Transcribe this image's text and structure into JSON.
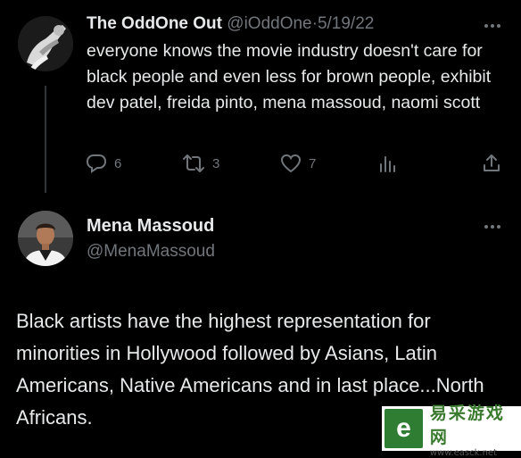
{
  "reply_tweet": {
    "display_name": "The OddOne Out",
    "handle": "@iOddOne",
    "separator": "·",
    "date": "5/19/22",
    "text": "everyone knows the movie industry doesn't care for black people and even less for brown people, exhibit dev patel, freida pinto, mena massoud, naomi scott",
    "actions": {
      "reply_count": "6",
      "retweet_count": "3",
      "like_count": "7"
    }
  },
  "main_tweet": {
    "display_name": "Mena Massoud",
    "handle": "@MenaMassoud",
    "text": "Black artists have the highest representation for minorities in Hollywood followed by Asians, Latin Americans, Native Americans and in last place...North Africans."
  },
  "watermark": {
    "logo_letter": "e",
    "site_name": "易采游戏网",
    "url": "www.easck.net"
  },
  "colors": {
    "background": "#000000",
    "text_primary": "#e7e9ea",
    "text_secondary": "#71767b",
    "thread_line": "#333639",
    "watermark_green": "#2e7d32"
  }
}
